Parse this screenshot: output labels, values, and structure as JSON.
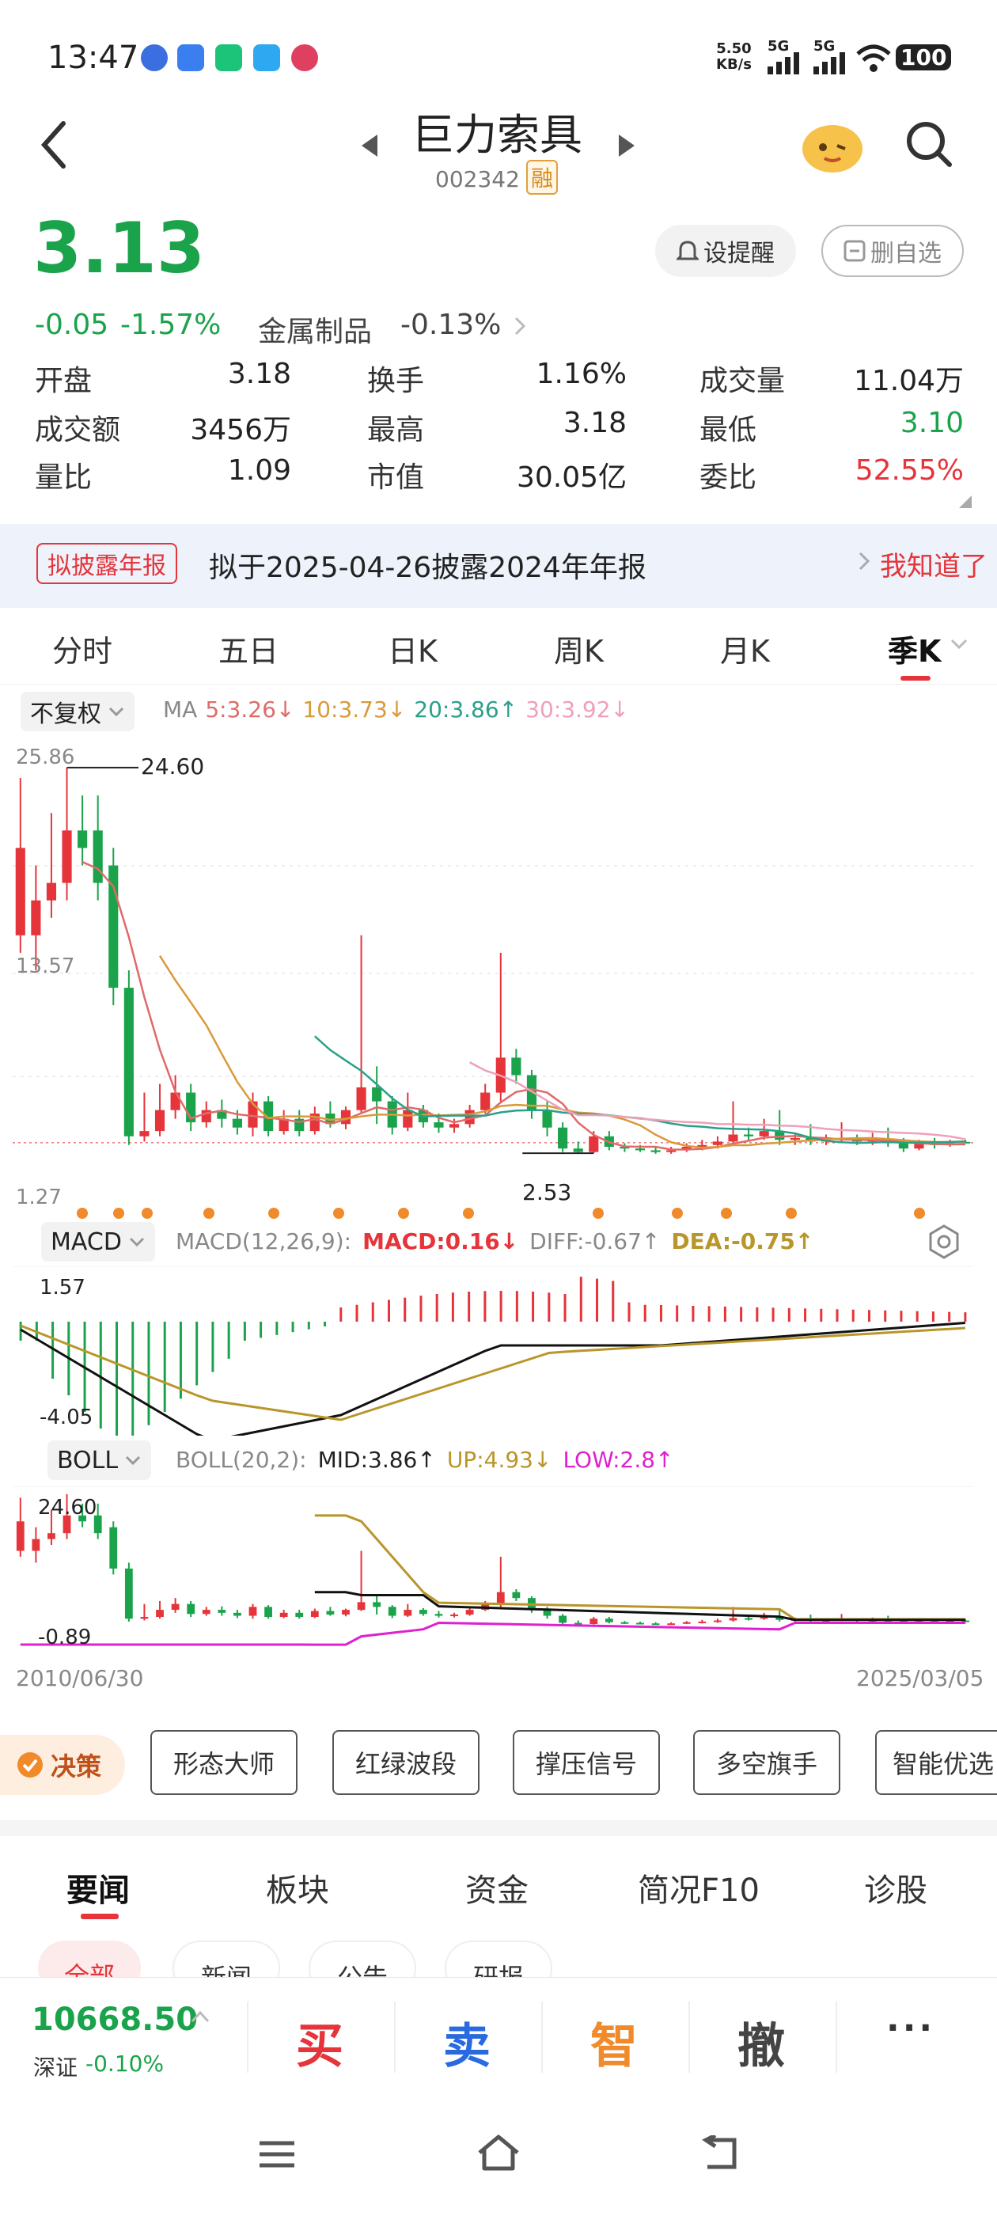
{
  "status": {
    "time": "13:47",
    "speed": "5.50",
    "speed_unit": "KB/s",
    "net1": "5G",
    "net2": "5G",
    "battery": "100"
  },
  "header": {
    "title": "巨力索具",
    "code": "002342",
    "badge": "融"
  },
  "price": {
    "last": "3.13",
    "change": "-0.05",
    "change_pct": "-1.57%",
    "sector": "金属制品",
    "sector_pct": "-0.13%",
    "alert_btn": "设提醒",
    "fav_btn": "删自选"
  },
  "stats": [
    {
      "label": "开盘",
      "value": "3.18"
    },
    {
      "label": "换手",
      "value": "1.16%"
    },
    {
      "label": "成交量",
      "value": "11.04万"
    },
    {
      "label": "成交额",
      "value": "3456万"
    },
    {
      "label": "最高",
      "value": "3.18"
    },
    {
      "label": "最低",
      "value": "3.10"
    },
    {
      "label": "量比",
      "value": "1.09"
    },
    {
      "label": "市值",
      "value": "30.05亿"
    },
    {
      "label": "委比",
      "value": "52.55%"
    }
  ],
  "notice": {
    "tag": "拟披露年报",
    "text": "拟于2025-04-26披露2024年年报",
    "action": "我知道了"
  },
  "period_tabs": [
    "分时",
    "五日",
    "日K",
    "周K",
    "月K",
    "季K"
  ],
  "ma": {
    "adjust": "不复权",
    "label": "MA",
    "ma5": "5:3.26↓",
    "ma10": "10:3.73↓",
    "ma20": "20:3.86↑",
    "ma30": "30:3.92↓"
  },
  "kline": {
    "y_top": "25.86",
    "y_mid": "13.57",
    "y_low": "1.27",
    "high_mark": "24.60",
    "low_mark": "2.53"
  },
  "macd": {
    "selector": "MACD",
    "params": "MACD(12,26,9):",
    "macd": "MACD:0.16↓",
    "diff": "DIFF:-0.67↑",
    "dea": "DEA:-0.75↑",
    "y_top": "1.57",
    "y_bottom": "-4.05"
  },
  "boll": {
    "selector": "BOLL",
    "params": "BOLL(20,2):",
    "mid": "MID:3.86↑",
    "up": "UP:4.93↓",
    "low": "LOW:2.8↑",
    "y_top": "24.60",
    "y_bottom": "-0.89",
    "date_start": "2010/06/30",
    "date_end": "2025/03/05"
  },
  "tools": {
    "decision": "决策",
    "items": [
      "形态大师",
      "红绿波段",
      "撑压信号",
      "多空旗手",
      "智能优选"
    ]
  },
  "news_tabs": [
    "要闻",
    "板块",
    "资金",
    "简况F10",
    "诊股"
  ],
  "news_sub": [
    "全部",
    "新闻",
    "公告",
    "研报"
  ],
  "index": {
    "value": "10668.50",
    "name": "深证",
    "pct": "-0.10%"
  },
  "actions": {
    "buy": "买",
    "sell": "卖",
    "smart": "智",
    "cancel": "撤",
    "more": "···"
  },
  "colors": {
    "up": "#e5343a",
    "down": "#1aa34a",
    "ma5": "#e06a6a",
    "ma10": "#d99a3a",
    "ma20": "#2aa08a",
    "ma30": "#f0a0b8",
    "macd_dea": "#b8962a",
    "boll_low": "#e020d0"
  }
}
